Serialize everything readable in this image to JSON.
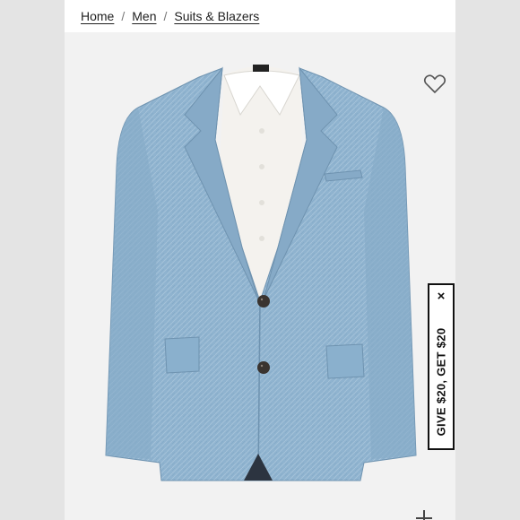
{
  "breadcrumb": {
    "items": [
      "Home",
      "Men",
      "Suits & Blazers"
    ],
    "separator": "/"
  },
  "product": {
    "image_subject": "light blue linen suit jacket over white dress shirt",
    "jacket_color": "#8fb3cf",
    "shirt_color": "#f4f2ee"
  },
  "promo": {
    "text": "GIVE $20, GET $20",
    "close_glyph": "×"
  },
  "icons": {
    "wishlist": "heart-outline-icon",
    "zoom": "plus-icon"
  }
}
